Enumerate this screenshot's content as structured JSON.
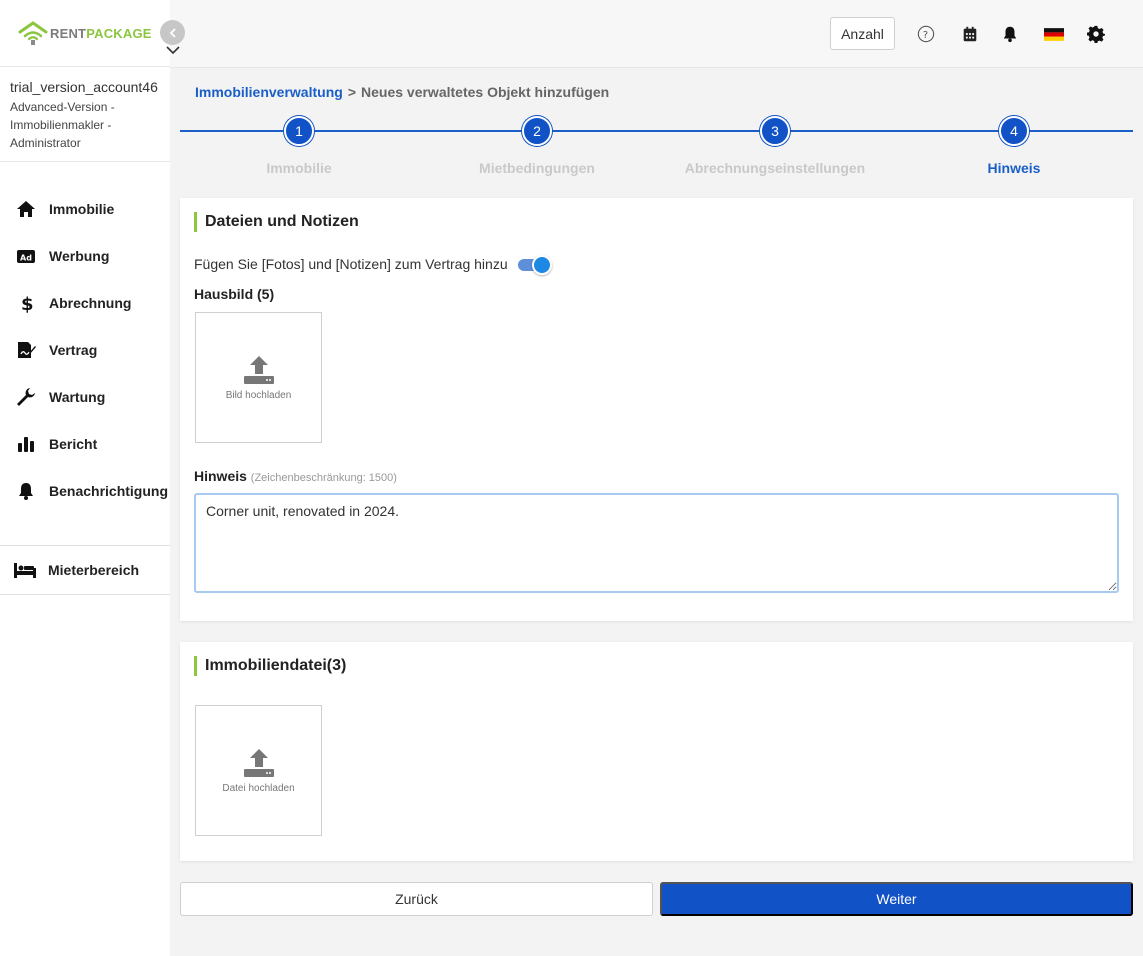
{
  "logo": {
    "part1": "RENT",
    "part2": "PACKAGE"
  },
  "account": {
    "name": "trial_version_account46",
    "role": "Advanced-Version - Immobilienmakler - Administrator"
  },
  "sidebar": {
    "items": [
      {
        "label": "Immobilie",
        "icon": "home-icon"
      },
      {
        "label": "Werbung",
        "icon": "ad-icon"
      },
      {
        "label": "Abrechnung",
        "icon": "dollar-icon"
      },
      {
        "label": "Vertrag",
        "icon": "contract-icon"
      },
      {
        "label": "Wartung",
        "icon": "wrench-icon"
      },
      {
        "label": "Bericht",
        "icon": "bar-chart-icon"
      },
      {
        "label": "Benachrichtigung",
        "icon": "bell-icon"
      }
    ],
    "tenant": {
      "label": "Mieterbereich",
      "icon": "bed-icon"
    }
  },
  "header": {
    "anzahl_label": "Anzahl"
  },
  "breadcrumb": {
    "root": "Immobilienverwaltung",
    "separator": ">",
    "current": "Neues verwaltetes Objekt hinzufügen"
  },
  "steps": [
    {
      "number": "1",
      "label": "Immobilie",
      "active": false
    },
    {
      "number": "2",
      "label": "Mietbedingungen",
      "active": false
    },
    {
      "number": "3",
      "label": "Abrechnungseinstellungen",
      "active": false
    },
    {
      "number": "4",
      "label": "Hinweis",
      "active": true
    }
  ],
  "files_section": {
    "title": "Dateien und Notizen",
    "toggle_label": "Fügen Sie [Fotos] und [Notizen] zum Vertrag hinzu",
    "house_image_label": "Hausbild (5)",
    "upload_image_text": "Bild hochladen",
    "note_label": "Hinweis",
    "note_hint": "(Zeichenbeschränkung: 1500)",
    "note_value": "Corner unit, renovated in 2024."
  },
  "property_file_section": {
    "title": "Immobiliendatei(3)",
    "upload_file_text": "Datei hochladen"
  },
  "actions": {
    "back_label": "Zurück",
    "next_label": "Weiter"
  },
  "colors": {
    "primary": "#1252c7",
    "accent": "#8cc63f"
  }
}
